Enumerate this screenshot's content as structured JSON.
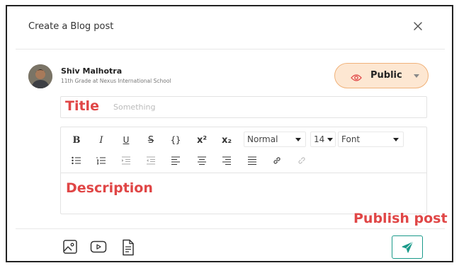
{
  "modal": {
    "title": "Create a Blog post"
  },
  "user": {
    "name": "Shiv Malhotra",
    "subtitle": "11th Grade at Nexus International School"
  },
  "visibility": {
    "selected": "Public"
  },
  "title_field": {
    "placeholder": "Something",
    "annotation": "Title"
  },
  "toolbar": {
    "bold": "B",
    "italic": "I",
    "underline": "U",
    "strike": "S",
    "code": "{}",
    "superscript": "x²",
    "subscript": "x₂",
    "heading_select": "Normal",
    "size_select": "14",
    "font_select": "Font"
  },
  "description": {
    "annotation": "Description"
  },
  "publish": {
    "annotation": "Publish post"
  },
  "colors": {
    "accent": "#1a9a8a",
    "annotation": "#e04646",
    "public_bg": "#fde7d2",
    "public_border": "#f0b27a"
  }
}
